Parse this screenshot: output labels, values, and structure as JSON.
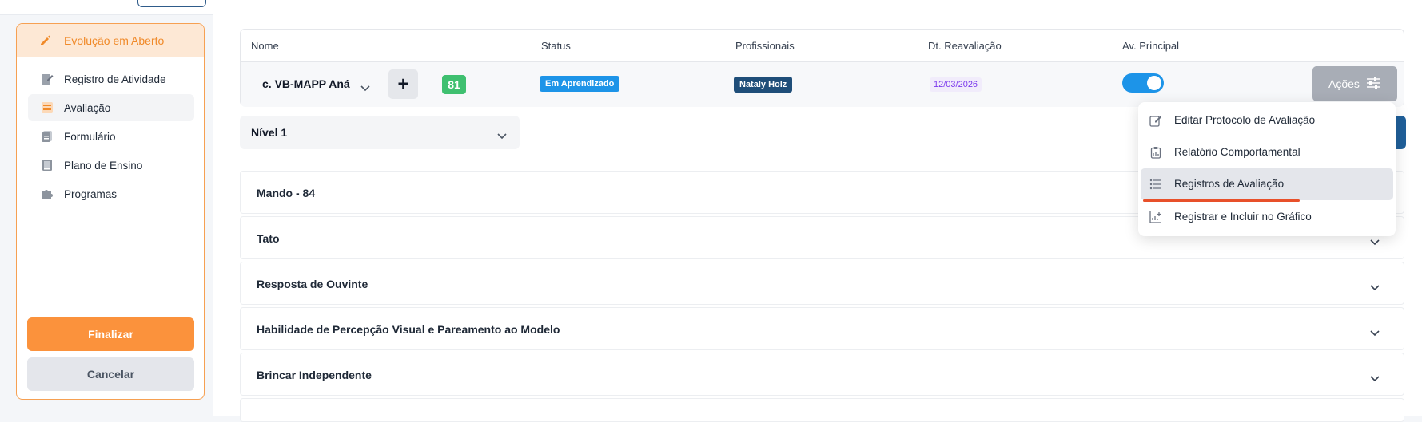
{
  "sidebar": {
    "header": "Evolução em Aberto",
    "items": [
      {
        "label": "Registro de Atividade",
        "icon": "edit-doc-icon"
      },
      {
        "label": "Avaliação",
        "icon": "checklist-icon"
      },
      {
        "label": "Formulário",
        "icon": "form-icon"
      },
      {
        "label": "Plano de Ensino",
        "icon": "book-icon"
      },
      {
        "label": "Programas",
        "icon": "puzzle-icon"
      }
    ],
    "finalize_label": "Finalizar",
    "cancel_label": "Cancelar",
    "accent": "#fb923c"
  },
  "table": {
    "columns": [
      "Nome",
      "Status",
      "Profissionais",
      "Dt. Reavaliação",
      "Av. Principal"
    ],
    "row": {
      "name": "c. VB-MAPP Aná",
      "plus": "+",
      "score": "81",
      "status": "Em Aprendizado",
      "professional": "Nataly Holz",
      "date": "12/03/2026",
      "principal_on": true,
      "actions_label": "Ações"
    }
  },
  "level_select": "Nível 1",
  "sections": [
    "Mando - 84",
    "Tato",
    "Resposta de Ouvinte",
    "Habilidade de Percepção Visual e Pareamento ao Modelo",
    "Brincar Independente"
  ],
  "menu": {
    "items": [
      {
        "label": "Editar Protocolo de Avaliação",
        "icon": "pencil-icon"
      },
      {
        "label": "Relatório Comportamental",
        "icon": "clipboard-icon"
      },
      {
        "label": "Registros de Avaliação",
        "icon": "list-icon"
      },
      {
        "label": "Registrar e Incluir no Gráfico",
        "icon": "chart-add-icon"
      }
    ],
    "highlighted_index": 2
  },
  "colors": {
    "status": "#1d94e8",
    "professional": "#1f4e79",
    "score": "#3fc070",
    "toggle": "#1d94e8"
  }
}
